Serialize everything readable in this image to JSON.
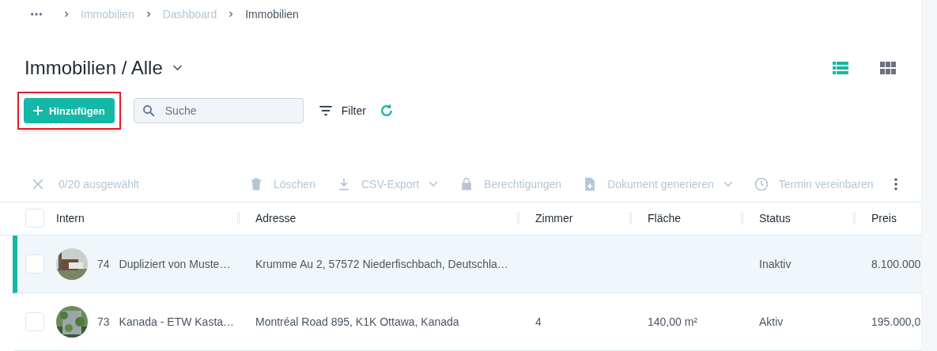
{
  "breadcrumb": [
    {
      "label": "Immobilien",
      "current": false
    },
    {
      "label": "Dashboard",
      "current": false
    },
    {
      "label": "Immobilien",
      "current": true
    }
  ],
  "title": "Immobilien / Alle",
  "views": [
    {
      "kind": "list",
      "selected": true
    },
    {
      "kind": "grid",
      "selected": false
    }
  ],
  "add_button": {
    "label": "Hinzufügen",
    "highlighted": true
  },
  "search": {
    "placeholder": "Suche"
  },
  "filter": {
    "label": "Filter"
  },
  "selection": {
    "count": "0/20 ausgewählt"
  },
  "actions": [
    {
      "kind": "delete",
      "label": "Löschen",
      "dropdown": false,
      "disabled": true
    },
    {
      "kind": "download",
      "label": "CSV-Export",
      "dropdown": true,
      "disabled": true
    },
    {
      "kind": "lock",
      "label": "Berechtigungen",
      "dropdown": false,
      "disabled": true
    },
    {
      "kind": "document",
      "label": "Dokument generieren",
      "dropdown": true,
      "disabled": true
    },
    {
      "kind": "clock",
      "label": "Termin vereinbaren",
      "dropdown": false,
      "disabled": true
    }
  ],
  "table": {
    "header_checkbox": {
      "checked": false
    },
    "columns": [
      "Intern",
      "Adresse",
      "Zimmer",
      "Fläche",
      "Status",
      "Preis"
    ],
    "rows": [
      {
        "selected": true,
        "checked": false,
        "number": "74",
        "name": "Dupliziert von Muste…",
        "address": "Krumme Au 2, 57572 Niederfischbach, Deutschla…",
        "status": "Inaktiv",
        "price": "8.100.000"
      },
      {
        "selected": false,
        "checked": false,
        "number": "73",
        "name": "Kanada - ETW Kasta…",
        "address": "Montréal Road 895, K1K Ottawa, Kanada",
        "rooms": "4",
        "area": "140,00 m²",
        "status": "Aktiv",
        "price": "195.000,0"
      }
    ]
  }
}
